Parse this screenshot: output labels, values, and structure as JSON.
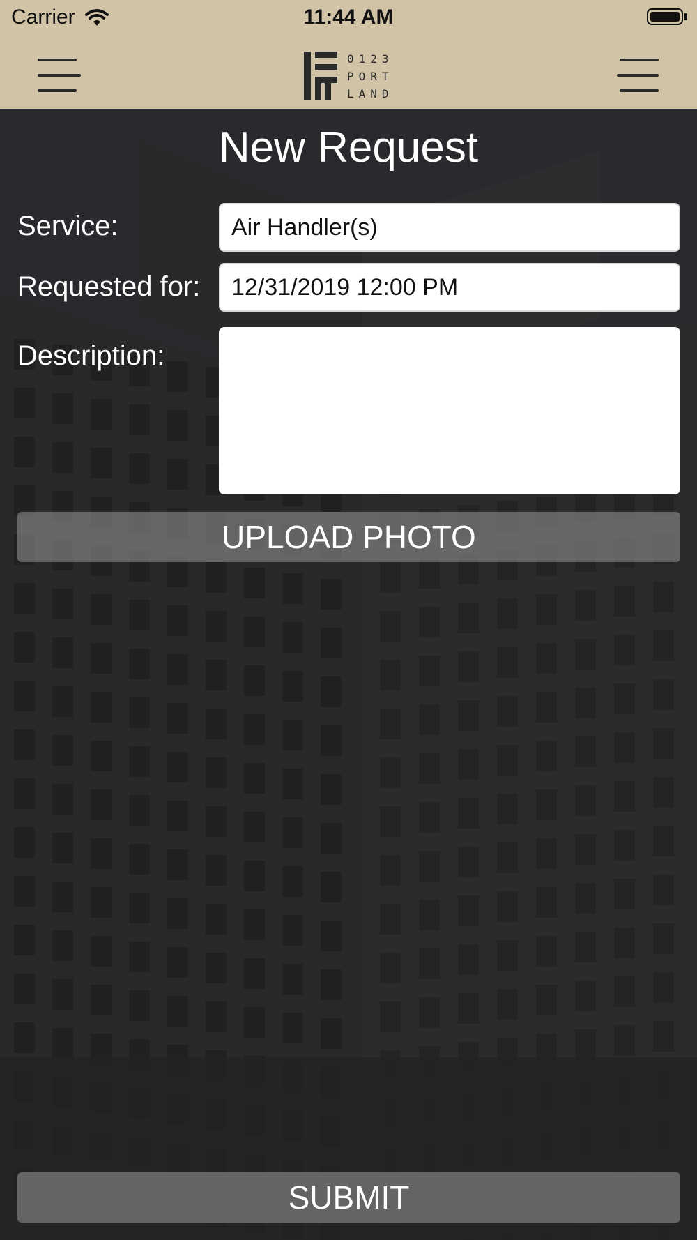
{
  "status_bar": {
    "carrier": "Carrier",
    "time": "11:44 AM"
  },
  "header": {
    "logo_lines": [
      "0123",
      "PORT",
      "LAND"
    ]
  },
  "page": {
    "title": "New Request"
  },
  "form": {
    "service_label": "Service:",
    "service_value": "Air Handler(s)",
    "requested_for_label": "Requested for:",
    "requested_for_value": "12/31/2019 12:00 PM",
    "description_label": "Description:",
    "description_value": ""
  },
  "buttons": {
    "upload_photo": "UPLOAD PHOTO",
    "submit": "SUBMIT"
  },
  "colors": {
    "header_bg": "#d1c4a6",
    "button_bg": "#8c8c8c",
    "text_light": "#ffffff"
  }
}
